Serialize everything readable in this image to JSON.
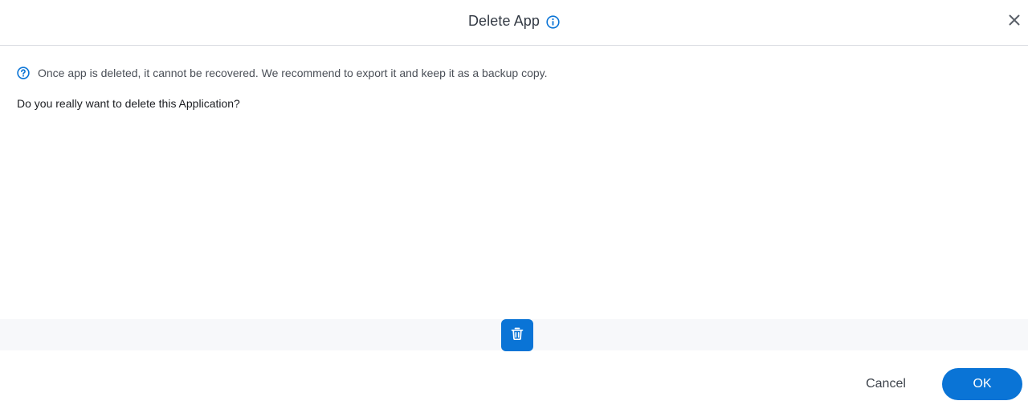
{
  "dialog": {
    "title": "Delete App",
    "title_icon": "info-icon",
    "close_icon": "close-icon"
  },
  "body": {
    "notice_icon": "question-circle-icon",
    "notice_text": "Once app is deleted, it cannot be recovered. We recommend to export it and keep it as a backup copy.",
    "question": "Do you really want to delete this Application?"
  },
  "toolbar": {
    "delete_icon": "trash-icon"
  },
  "footer": {
    "cancel_label": "Cancel",
    "ok_label": "OK"
  },
  "colors": {
    "accent": "#0a74d6",
    "band": "#f7f8fa",
    "divider": "#d9dce1"
  }
}
